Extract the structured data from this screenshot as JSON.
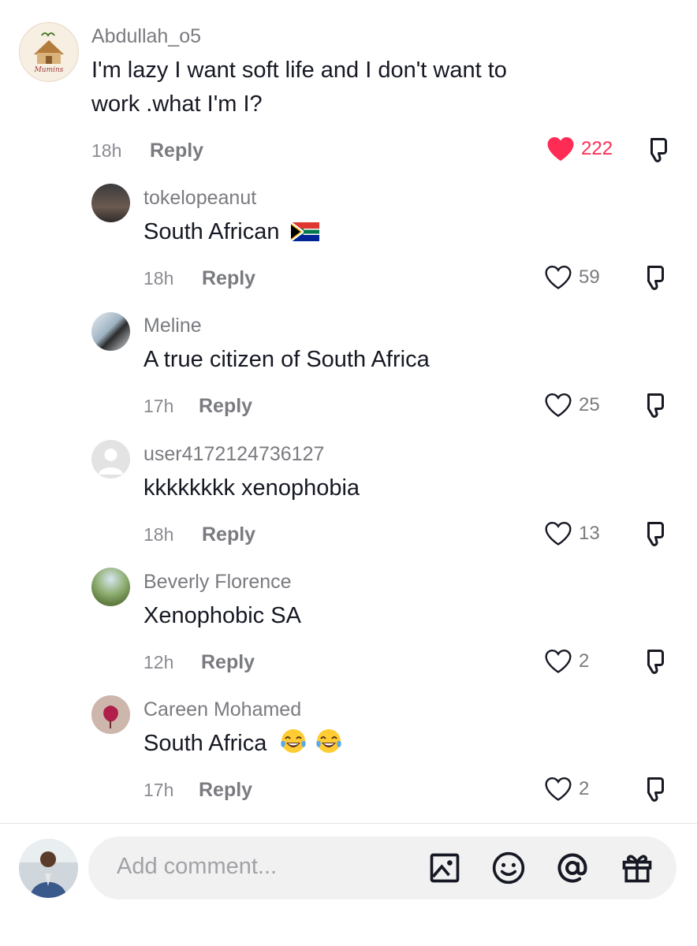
{
  "comments": [
    {
      "username": "Abdullah_o5",
      "text_lines": [
        "I'm lazy I want soft life and I don't want to",
        "work .what I'm I?"
      ],
      "time": "18h",
      "reply": "Reply",
      "likes": "222",
      "liked": true
    },
    {
      "username": "tokelopeanut",
      "text": "South African",
      "time": "18h",
      "reply": "Reply",
      "likes": "59",
      "liked": false
    },
    {
      "username": "Meline",
      "text": "A true citizen of South Africa",
      "time": "17h",
      "reply": "Reply",
      "likes": "25",
      "liked": false
    },
    {
      "username": "user4172124736127",
      "text": "kkkkkkkk xenophobia",
      "time": "18h",
      "reply": "Reply",
      "likes": "13",
      "liked": false
    },
    {
      "username": "Beverly Florence",
      "text": "Xenophobic SA",
      "time": "12h",
      "reply": "Reply",
      "likes": "2",
      "liked": false
    },
    {
      "username": "Careen Mohamed",
      "text": "South Africa",
      "time": "17h",
      "reply": "Reply",
      "likes": "2",
      "liked": false
    }
  ],
  "first_avatar_logo_text": "Mumins",
  "emojis": {
    "flag": "south-africa-flag",
    "laugh": "face-with-tears-of-joy"
  },
  "composer": {
    "placeholder": "Add comment...",
    "icons": [
      "image-icon",
      "emoji-icon",
      "mention-icon",
      "gift-icon"
    ]
  },
  "colors": {
    "accent": "#fe2c55",
    "muted": "#7a7b80",
    "text": "#161823",
    "input_bg": "#f1f1f2"
  }
}
